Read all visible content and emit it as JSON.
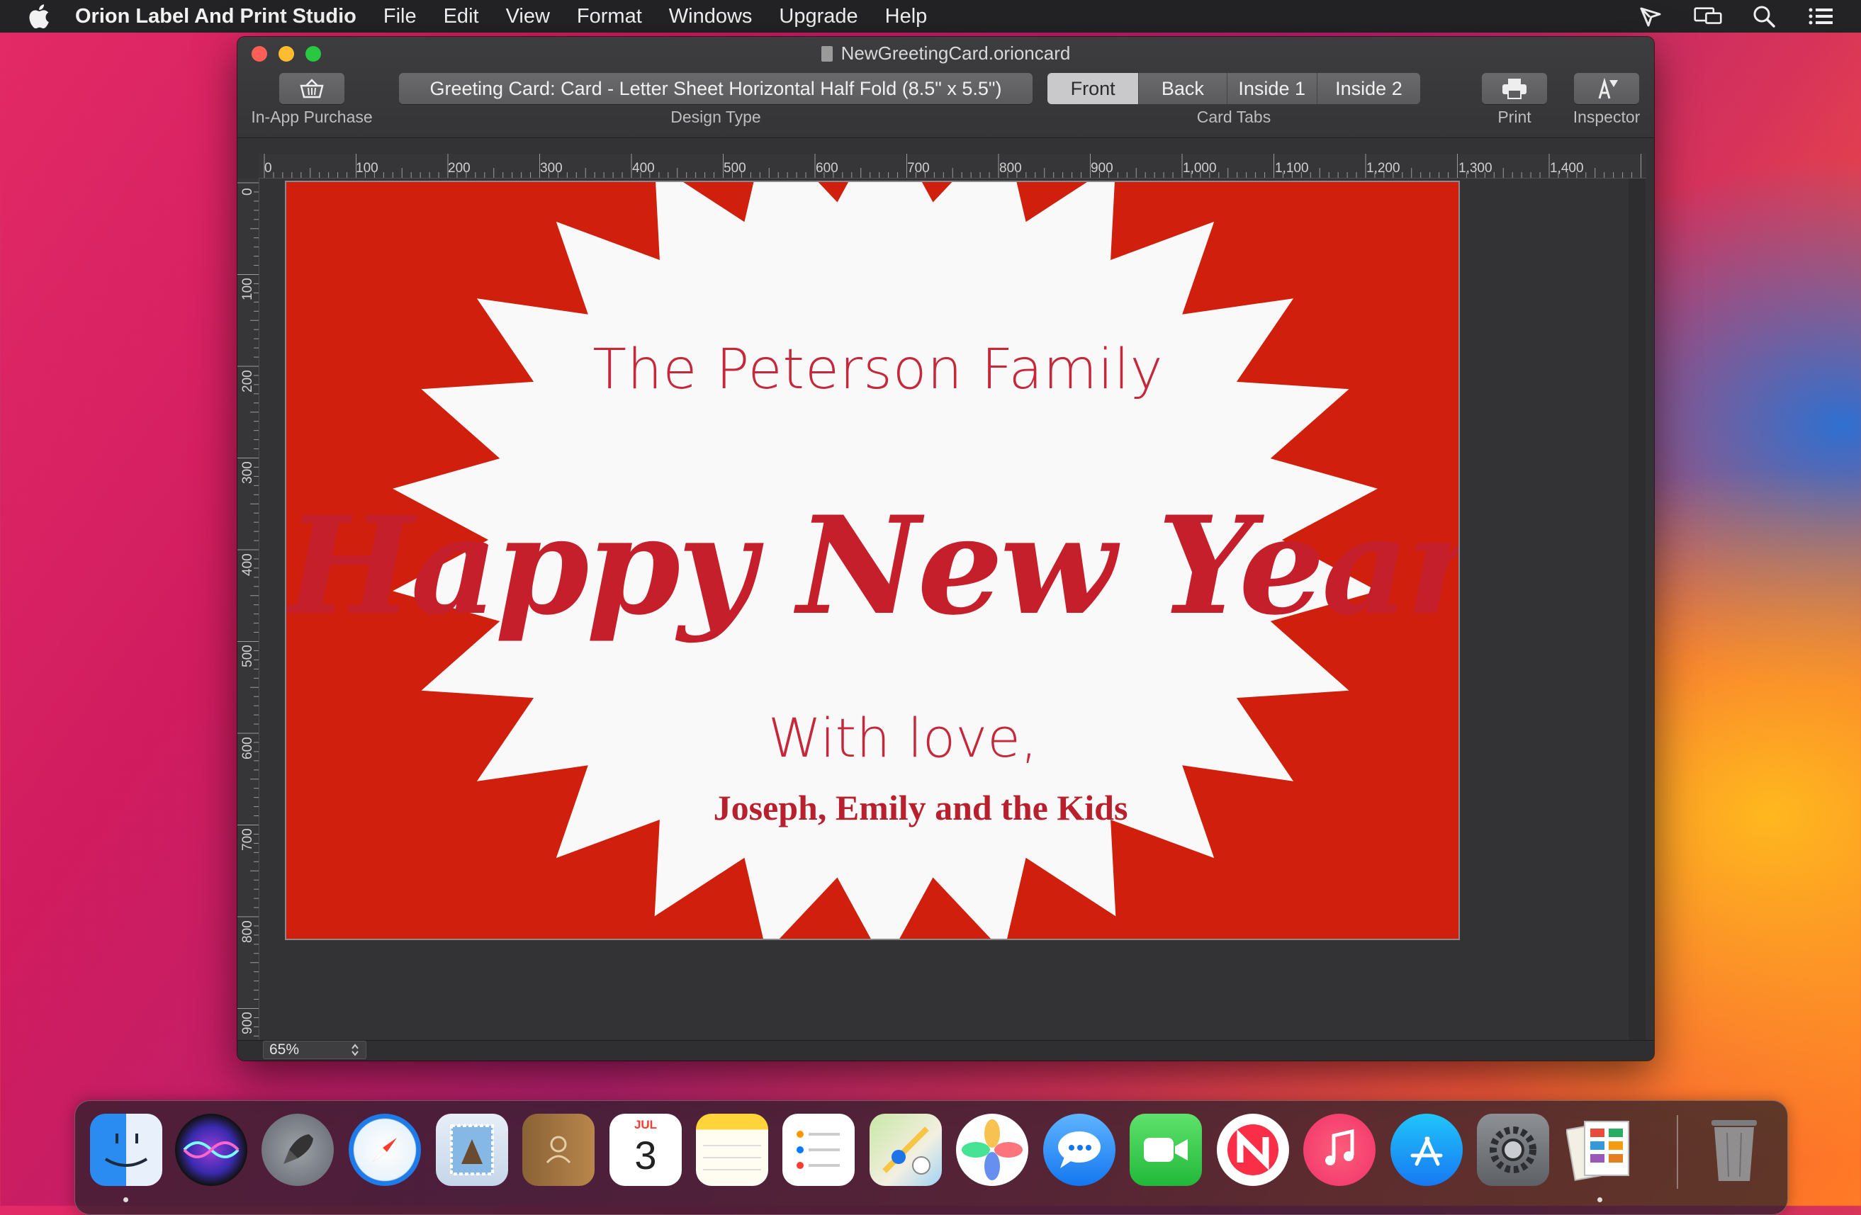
{
  "menubar": {
    "app_name": "Orion Label And Print Studio",
    "items": [
      "File",
      "Edit",
      "View",
      "Format",
      "Windows",
      "Upgrade",
      "Help"
    ]
  },
  "window": {
    "title": "NewGreetingCard.orioncard",
    "toolbar": {
      "purchase_caption": "In-App Purchase",
      "design_type_value": "Greeting Card: Card - Letter Sheet Horizontal Half Fold (8.5\" x 5.5\")",
      "design_type_caption": "Design Type",
      "card_tabs": [
        "Front",
        "Back",
        "Inside 1",
        "Inside 2"
      ],
      "card_tabs_selected": "Front",
      "card_tabs_caption": "Card Tabs",
      "print_caption": "Print",
      "inspector_caption": "Inspector"
    },
    "ruler_h_labels": [
      "0",
      "100",
      "200",
      "300",
      "400",
      "500",
      "600",
      "700",
      "800",
      "900",
      "1,000",
      "1,100",
      "1,200",
      "1,300",
      "1,400"
    ],
    "ruler_v_labels": [
      "0",
      "100",
      "200",
      "300",
      "400",
      "500",
      "600",
      "700",
      "800",
      "900"
    ],
    "zoom": "65%"
  },
  "card": {
    "family_line": "The Peterson Family",
    "greeting": "Happy New Year!",
    "love_line": "With love,",
    "signed_line": "Joseph, Emily and the Kids",
    "background_color": "#d01f0c",
    "burst_color": "#f9f9f9"
  },
  "dock": {
    "apps": [
      "finder-icon",
      "siri-icon",
      "launchpad-icon",
      "safari-icon",
      "mail-icon",
      "contacts-icon",
      "calendar-icon",
      "notes-icon",
      "reminders-icon",
      "maps-icon",
      "photos-icon",
      "messages-icon",
      "facetime-icon",
      "news-icon",
      "music-icon",
      "app-store-icon",
      "system-preferences-icon",
      "orion-label-studio-icon",
      "trash-icon"
    ],
    "calendar_month": "JUL",
    "calendar_day": "3"
  }
}
